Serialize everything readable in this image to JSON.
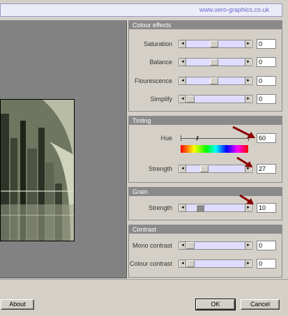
{
  "header": {
    "url_text": "www.xero-graphics.co.uk"
  },
  "colour_effects": {
    "title": "Colour effects",
    "rows": [
      {
        "label": "Saturation",
        "value": "0"
      },
      {
        "label": "Balance",
        "value": "0"
      },
      {
        "label": "Flourescence",
        "value": "0"
      },
      {
        "label": "Simplify",
        "value": "0"
      }
    ]
  },
  "tinting": {
    "title": "Tinting",
    "hue_label": "Hue",
    "hue_value": "60",
    "strength_label": "Strength",
    "strength_value": "27"
  },
  "grain": {
    "title": "Grain",
    "strength_label": "Strength",
    "strength_value": "10"
  },
  "contrast": {
    "title": "Contrast",
    "rows": [
      {
        "label": "Mono contrast",
        "value": "0"
      },
      {
        "label": "Colour contrast",
        "value": "0"
      }
    ]
  },
  "buttons": {
    "about": "About",
    "ok": "OK",
    "cancel": "Cancel"
  },
  "icons": {
    "arrow_left": "arrow-left-icon",
    "arrow_right": "arrow-right-icon",
    "annotation": "red-arrow-icon"
  },
  "colors": {
    "panel_title_bg": "#8a8a8a",
    "slider_bg": "#e0dcff",
    "annotation_arrow": "#8b0000"
  }
}
